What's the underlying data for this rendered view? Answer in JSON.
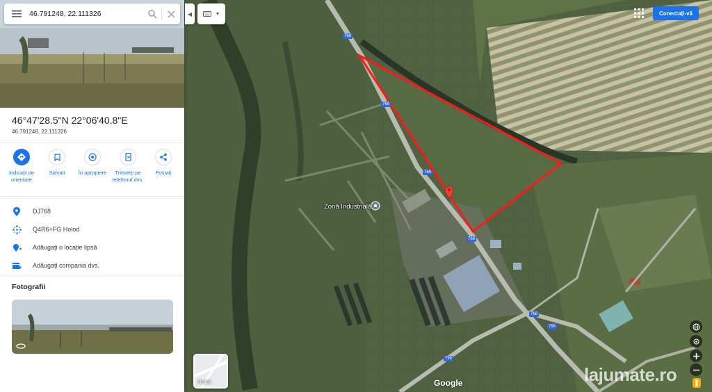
{
  "search": {
    "query": "46.791248, 22.111326"
  },
  "place": {
    "title": "46°47'28.5\"N 22°06'40.8\"E",
    "subtitle": "46.791248, 22.111326"
  },
  "actions": [
    {
      "label": "Indicații de orientare",
      "icon": "directions-icon"
    },
    {
      "label": "Salvați",
      "icon": "bookmark-icon"
    },
    {
      "label": "În apropiere",
      "icon": "nearby-icon"
    },
    {
      "label": "Trimiteți pe telefonul dvs.",
      "icon": "send-to-phone-icon"
    },
    {
      "label": "Postați",
      "icon": "share-icon"
    }
  ],
  "info": [
    {
      "text": "DJ768",
      "icon": "location-pin-icon"
    },
    {
      "text": "Q4R6+FG Holod",
      "icon": "plus-code-icon"
    },
    {
      "text": "Adăugați o locație lipsă",
      "icon": "add-location-icon"
    },
    {
      "text": "Adăugați compania dvs.",
      "icon": "add-business-icon"
    }
  ],
  "photos_title": "Fotografii",
  "header": {
    "signin_label": "Conectați-vă"
  },
  "map": {
    "poi_label": "Zonă Industrială",
    "road_shields": [
      "768",
      "768",
      "768",
      "768",
      "768",
      "795",
      "795"
    ],
    "layer_label": "Hartă",
    "google_logo": "Google",
    "watermark": "lajumate.ro"
  },
  "colors": {
    "accent": "#1a73e8",
    "boundary": "#ff1a1a",
    "pin": "#ea4335"
  }
}
